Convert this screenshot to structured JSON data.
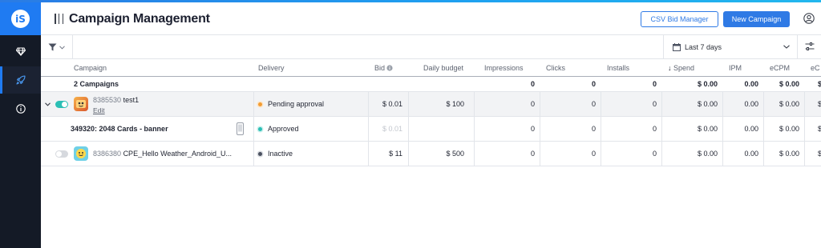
{
  "app": {
    "logo_text": "iS",
    "title": "Campaign Management",
    "brand_color": "#1f7bf2"
  },
  "sidebar": {
    "items": [
      {
        "icon": "diamond-icon",
        "active": false
      },
      {
        "icon": "rocket-icon",
        "active": true
      },
      {
        "icon": "info-icon",
        "active": false
      }
    ]
  },
  "header": {
    "csv_button": "CSV Bid Manager",
    "new_campaign_button": "New Campaign",
    "menu_icon": "columns-icon",
    "user_icon": "user-icon"
  },
  "toolbar": {
    "filter_icon": "filter-icon",
    "date_range": "Last 7 days",
    "settings_icon": "sliders-icon"
  },
  "table": {
    "columns": [
      "Campaign",
      "Delivery",
      "Bid",
      "Daily budget",
      "Impressions",
      "Clicks",
      "Installs",
      "Spend",
      "IPM",
      "eCPM",
      "eC"
    ],
    "sort_indicator": "↓",
    "totals": {
      "label": "2 Campaigns",
      "impressions": "0",
      "clicks": "0",
      "installs": "0",
      "spend": "$ 0.00",
      "ipm": "0.00",
      "ecpm": "$ 0.00",
      "ec": "$"
    },
    "rows": [
      {
        "id": "8385530",
        "name": "test1",
        "edit": "Edit",
        "delivery": "Pending approval",
        "status": "pending",
        "bid": "$ 0.01",
        "budget": "$ 100",
        "impressions": "0",
        "clicks": "0",
        "installs": "0",
        "spend": "$ 0.00",
        "ipm": "0.00",
        "ecpm": "$ 0.00",
        "ec": "$"
      },
      {
        "name": "349320: 2048 Cards - banner",
        "delivery": "Approved",
        "status": "approved",
        "bid": "$ 0.01",
        "budget": "",
        "impressions": "0",
        "clicks": "0",
        "installs": "0",
        "spend": "$ 0.00",
        "ipm": "0.00",
        "ecpm": "$ 0.00",
        "ec": "$"
      },
      {
        "id": "8386380",
        "name": "CPE_Hello Weather_Android_U...",
        "delivery": "Inactive",
        "status": "inactive",
        "bid": "$ 11",
        "budget": "$ 500",
        "impressions": "0",
        "clicks": "0",
        "installs": "0",
        "spend": "$ 0.00",
        "ipm": "0.00",
        "ecpm": "$ 0.00",
        "ec": "$"
      }
    ]
  }
}
